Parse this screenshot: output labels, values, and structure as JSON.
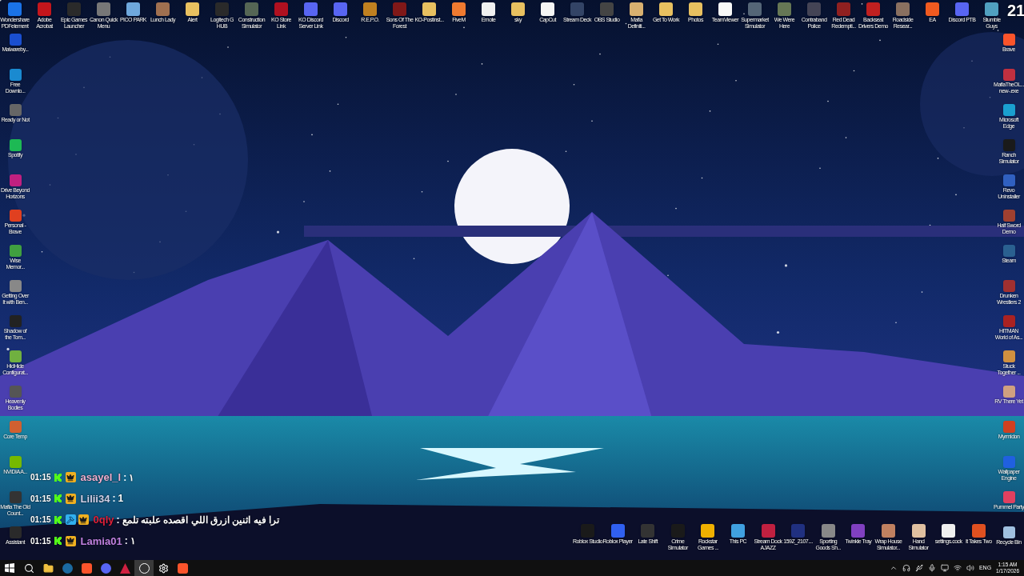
{
  "top_icons": [
    {
      "label": "Wondershare PDFelement",
      "color": "#1a73e8"
    },
    {
      "label": "Adobe Acrobat",
      "color": "#c4161c"
    },
    {
      "label": "Epic Games Launcher",
      "color": "#2a2a2a"
    },
    {
      "label": "Canon Quick Menu",
      "color": "#777777"
    },
    {
      "label": "PICO PARK",
      "color": "#6fa8dc"
    },
    {
      "label": "Lunch Lady",
      "color": "#a07050"
    },
    {
      "label": "Alert",
      "color": "#e8c060"
    },
    {
      "label": "Logitech G HUB",
      "color": "#2a2a2a"
    },
    {
      "label": "Construction Simulator",
      "color": "#556655"
    },
    {
      "label": "KO Store Link",
      "color": "#b01020"
    },
    {
      "label": "KO Discord Server Link",
      "color": "#5865f2"
    },
    {
      "label": "Discord",
      "color": "#5865f2"
    },
    {
      "label": "R.E.P.O.",
      "color": "#c08020"
    },
    {
      "label": "Sons Of The Forest",
      "color": "#801818"
    },
    {
      "label": "KO-Postinst...",
      "color": "#e8c060"
    },
    {
      "label": "FiveM",
      "color": "#f07a30"
    },
    {
      "label": "Emote",
      "color": "#f0f0f0"
    },
    {
      "label": "sky",
      "color": "#e8c060"
    },
    {
      "label": "CapCut",
      "color": "#f5f5f5"
    },
    {
      "label": "Stream Deck",
      "color": "#334466"
    },
    {
      "label": "OBS Studio",
      "color": "#444444"
    },
    {
      "label": "Mafia Definiti...",
      "color": "#d8b070"
    },
    {
      "label": "Get To Work",
      "color": "#e8c060"
    },
    {
      "label": "Photos",
      "color": "#e8c060"
    },
    {
      "label": "TeamViewer",
      "color": "#f8f8f8"
    },
    {
      "label": "Supermarket Simulator",
      "color": "#556677"
    },
    {
      "label": "We Were Here",
      "color": "#667755"
    },
    {
      "label": "Contraband Police",
      "color": "#444455"
    },
    {
      "label": "Red Dead Redempti...",
      "color": "#902020"
    },
    {
      "label": "Backseat Drivers Demo",
      "color": "#c02020"
    },
    {
      "label": "Roadside Resear...",
      "color": "#8a7060"
    },
    {
      "label": "EA",
      "color": "#f05a20"
    },
    {
      "label": "Discord PTB",
      "color": "#5865f2"
    },
    {
      "label": "Stumble Guys",
      "color": "#50a0c0"
    }
  ],
  "overlay_number": "21",
  "left_icons": [
    {
      "label": "Malwareby...",
      "color": "#1a4fd0"
    },
    {
      "label": "Free Downlo...",
      "color": "#1a8ad0"
    },
    {
      "label": "Ready or Not",
      "color": "#666666"
    },
    {
      "label": "Spotify",
      "color": "#1db954"
    },
    {
      "label": "Drive Beyond Horizons",
      "color": "#c02080"
    },
    {
      "label": "Personal - Brave",
      "color": "#e04020"
    },
    {
      "label": "Wise Memor...",
      "color": "#40a040"
    },
    {
      "label": "Getting Over It with Ben...",
      "color": "#888888"
    },
    {
      "label": "Shadow of the Tom...",
      "color": "#222222"
    },
    {
      "label": "HidHide Configurat...",
      "color": "#70b040"
    },
    {
      "label": "Heavenly Bodies",
      "color": "#555555"
    },
    {
      "label": "Core Temp",
      "color": "#d06030"
    },
    {
      "label": "NVIDIA A...",
      "color": "#76b900"
    },
    {
      "label": "Mafia The Old Count...",
      "color": "#333333"
    },
    {
      "label": "Assistant",
      "color": "#2a2a2a"
    }
  ],
  "right_icons": [
    {
      "label": "Brave",
      "color": "#fb542b"
    },
    {
      "label": "MafiaTheOL... new-.exe",
      "color": "#c03040"
    },
    {
      "label": "Microsoft Edge",
      "color": "#1aa0d0"
    },
    {
      "label": "Ranch Simulator",
      "color": "#1a1a1a"
    },
    {
      "label": "Revo Uninstaller",
      "color": "#3060c0"
    },
    {
      "label": "Half Sword Demo",
      "color": "#a04030"
    },
    {
      "label": "Steam",
      "color": "#2a6090"
    },
    {
      "label": "Drunken Wrestlers 2",
      "color": "#a03030"
    },
    {
      "label": "HITMAN World of As...",
      "color": "#aa2222"
    },
    {
      "label": "Stuck Together ...",
      "color": "#d09040"
    },
    {
      "label": "RV There Yet",
      "color": "#d0a080"
    },
    {
      "label": "Myrmidon",
      "color": "#d04020"
    },
    {
      "label": "Wallpaper Engine",
      "color": "#2060e0"
    },
    {
      "label": "Pummel Party",
      "color": "#e04060"
    },
    {
      "label": "Recycle Bin",
      "color": "#a0c0e0"
    }
  ],
  "bottom_icons": [
    {
      "label": "Roblox Studio",
      "color": "#1a1a1a"
    },
    {
      "label": "Roblox Player",
      "color": "#3060f0"
    },
    {
      "label": "Late Shift",
      "color": "#333333"
    },
    {
      "label": "Crime Simulator",
      "color": "#1a1a1a"
    },
    {
      "label": "Rockstar Games ...",
      "color": "#f0b000"
    },
    {
      "label": "This PC",
      "color": "#40a0e0"
    },
    {
      "label": "Stream Dock AJAZZ",
      "color": "#c02040"
    },
    {
      "label": "159Z_2107....",
      "color": "#203080"
    },
    {
      "label": "Sporting Goods Sh...",
      "color": "#888888"
    },
    {
      "label": "Twinkle Tray",
      "color": "#8040c0"
    },
    {
      "label": "Wrap House Simulator...",
      "color": "#c08060"
    },
    {
      "label": "Hand Simulator",
      "color": "#e0c0a0"
    },
    {
      "label": "settings.cock",
      "color": "#f0f0f0"
    },
    {
      "label": "It Takes Two",
      "color": "#e05020"
    }
  ],
  "chat": [
    {
      "time": "01:15",
      "badges": [
        {
          "kind": "kick"
        },
        {
          "kind": "crown"
        }
      ],
      "user": "asayel_l",
      "color": "#f0b0d0",
      "separator": ":",
      "message": "١"
    },
    {
      "time": "01:15",
      "badges": [
        {
          "kind": "kick"
        },
        {
          "kind": "crown"
        }
      ],
      "user": "Lilii34",
      "color": "#d0d0e8",
      "separator": ":",
      "message": "1"
    },
    {
      "time": "01:15",
      "badges": [
        {
          "kind": "kick"
        },
        {
          "kind": "moderator"
        },
        {
          "kind": "crown"
        }
      ],
      "user": "0qly",
      "color": "#e0203a",
      "separator": ":",
      "message": "ترا فيه اثنين ازرق اللي اقصده علبته تلمع"
    },
    {
      "time": "01:15",
      "badges": [
        {
          "kind": "kick"
        },
        {
          "kind": "crown"
        }
      ],
      "user": "Lamia01",
      "color": "#c080e0",
      "separator": ":",
      "message": "١"
    }
  ],
  "taskbar": {
    "apps": [
      {
        "kind": "start",
        "selected": false
      },
      {
        "kind": "search",
        "selected": false
      },
      {
        "kind": "folder",
        "selected": false
      },
      {
        "kind": "steam",
        "selected": false
      },
      {
        "kind": "brave",
        "selected": false
      },
      {
        "kind": "discord",
        "selected": false
      },
      {
        "kind": "streamdock",
        "selected": false
      },
      {
        "kind": "obs",
        "selected": true
      },
      {
        "kind": "steelseries",
        "selected": false
      },
      {
        "kind": "brave",
        "selected": false
      }
    ],
    "language": "ENG",
    "time": "1:15 AM",
    "date": "1/17/2026"
  }
}
